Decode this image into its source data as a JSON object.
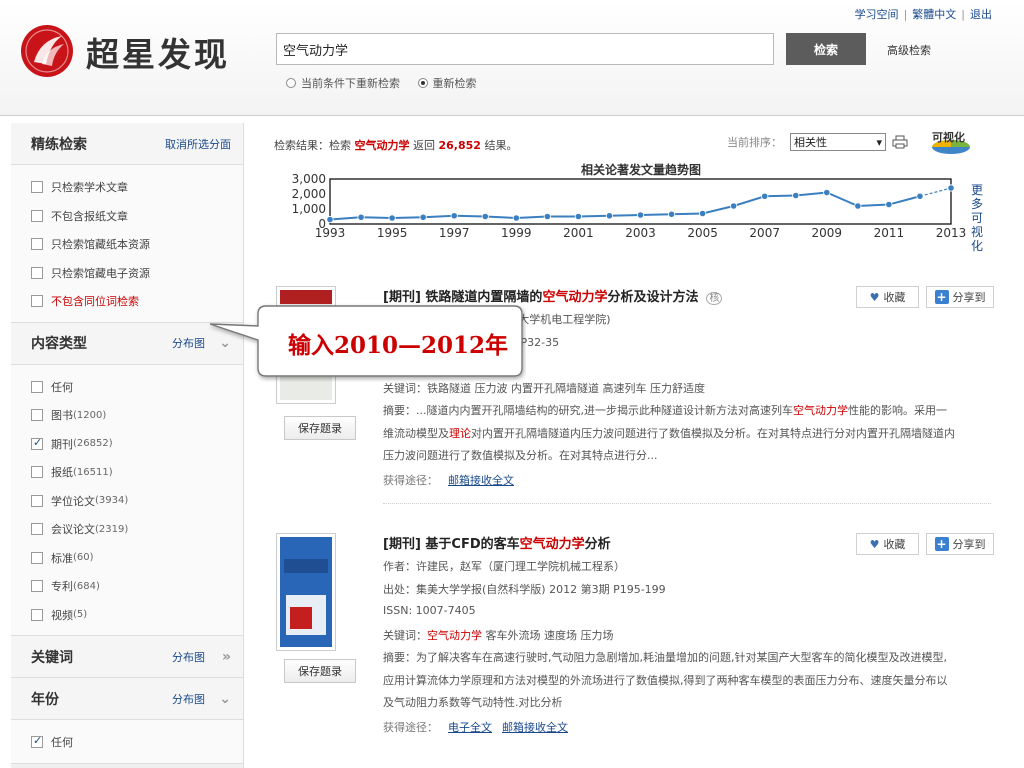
{
  "header": {
    "top_links": [
      "学习空间",
      "繁體中文",
      "退出"
    ],
    "logo_text": "超星发现",
    "search_value": "空气动力学",
    "search_button": "检索",
    "advanced_search": "高级检索",
    "search_modes": [
      {
        "label": "当前条件下重新检索",
        "selected": false
      },
      {
        "label": "重新检索",
        "selected": true
      }
    ]
  },
  "sidebar": {
    "refine": {
      "title": "精练检索",
      "action": "取消所选分面",
      "items": [
        {
          "label": "只检索学术文章",
          "checked": false,
          "red": false
        },
        {
          "label": "不包含报纸文章",
          "checked": false,
          "red": false
        },
        {
          "label": "只检索馆藏纸本资源",
          "checked": false,
          "red": false
        },
        {
          "label": "只检索馆藏电子资源",
          "checked": false,
          "red": false
        },
        {
          "label": "不包含同位词检索",
          "checked": false,
          "red": true
        }
      ]
    },
    "content_type": {
      "title": "内容类型",
      "action": "分布图",
      "arrow": "»",
      "items": [
        {
          "label": "任何",
          "count": "",
          "checked": false
        },
        {
          "label": "图书",
          "count": "(1200)",
          "checked": false
        },
        {
          "label": "期刊",
          "count": "(26852)",
          "checked": true
        },
        {
          "label": "报纸",
          "count": "(16511)",
          "checked": false
        },
        {
          "label": "学位论文",
          "count": "(3934)",
          "checked": false
        },
        {
          "label": "会议论文",
          "count": "(2319)",
          "checked": false
        },
        {
          "label": "标准",
          "count": "(60)",
          "checked": false
        },
        {
          "label": "专利",
          "count": "(684)",
          "checked": false
        },
        {
          "label": "视频",
          "count": "(5)",
          "checked": false
        }
      ]
    },
    "keywords": {
      "title": "关键词",
      "action": "分布图",
      "arrow": "»"
    },
    "year": {
      "title": "年份",
      "action": "分布图",
      "arrow": "»",
      "items": [
        {
          "label": "任何",
          "checked": true
        }
      ]
    }
  },
  "results": {
    "summary_prefix": "检索结果：检索",
    "keyword": "空气动力学",
    "summary_mid": "返回",
    "count": "26,852",
    "summary_suffix": "结果。",
    "sort_label": "当前排序：",
    "sort_value": "相关性",
    "viz_label": "可视化"
  },
  "chart_data": {
    "type": "line",
    "title": "相关论著发文量趋势图",
    "side_link": "更多可视化",
    "x": [
      1993,
      1994,
      1995,
      1996,
      1997,
      1998,
      1999,
      2000,
      2001,
      2002,
      2003,
      2004,
      2005,
      2006,
      2007,
      2008,
      2009,
      2010,
      2011,
      2012,
      2013
    ],
    "values": [
      300,
      450,
      400,
      450,
      550,
      500,
      400,
      500,
      500,
      550,
      600,
      650,
      700,
      1200,
      1850,
      1900,
      2100,
      1200,
      1300,
      1850,
      2400
    ],
    "x_ticks": [
      1993,
      1995,
      1997,
      1999,
      2001,
      2003,
      2005,
      2007,
      2009,
      2011,
      2013
    ],
    "y_ticks": [
      "3,000",
      "2,000",
      "1,000",
      "0"
    ],
    "ylim": [
      0,
      3000
    ],
    "line_color": "#3a7fbf"
  },
  "records": [
    {
      "type": "[期刊]",
      "title_pre": "铁路隧道内置隔墙的",
      "title_hl": "空气动力学",
      "title_post": "分析及设计方法",
      "core": "核",
      "fav": "收藏",
      "share": "分享到",
      "authors": "(交通大学机电工程学院)",
      "source": "S1期 P32-35",
      "issn": "",
      "keywords_line": "关键词：铁路隧道 压力波 内置开孔隔墙隧道 高速列车 压力舒适度",
      "abstract_lines": [
        "摘要：...隧道内内置开孔隔墙结构的研究,进一步揭示此种隧道设计新方法对高速列车空气动力学性能的影响。采用一",
        "维流动模型及理论对内置开孔隔墙隧道内压力波问题进行了数值模拟及分析。在对其特点进行分对内置开孔隔墙隧道内",
        "压力波问题进行了数值模拟及分析。在对其特点进行分..."
      ],
      "get_label": "获得途径：",
      "links": [
        "邮箱接收全文"
      ],
      "save": "保存题录"
    },
    {
      "type": "[期刊]",
      "title_pre": "基于CFD的客车",
      "title_hl": "空气动力学",
      "title_post": "分析",
      "core": "",
      "fav": "收藏",
      "share": "分享到",
      "authors": "作者：许建民，赵军（厦门理工学院机械工程系）",
      "source": "出处：集美大学学报(自然科学版) 2012 第3期 P195-199",
      "issn": "ISSN: 1007-7405",
      "keywords_line": "关键词：空气动力学  客车外流场  速度场  压力场",
      "abstract_lines": [
        "摘要：为了解决客车在高速行驶时,气动阻力急剧增加,耗油量增加的问题,针对某国产大型客车的简化模型及改进模型,",
        "应用计算流体力学原理和方法对模型的外流场进行了数值模拟,得到了两种客车模型的表面压力分布、速度矢量分布以",
        "及气动阻力系数等气动特性.对比分析"
      ],
      "get_label": "获得途径：",
      "links": [
        "电子全文",
        "邮箱接收全文"
      ],
      "save": "保存题录"
    }
  ],
  "callout": {
    "text": "输入2010—2012年"
  }
}
